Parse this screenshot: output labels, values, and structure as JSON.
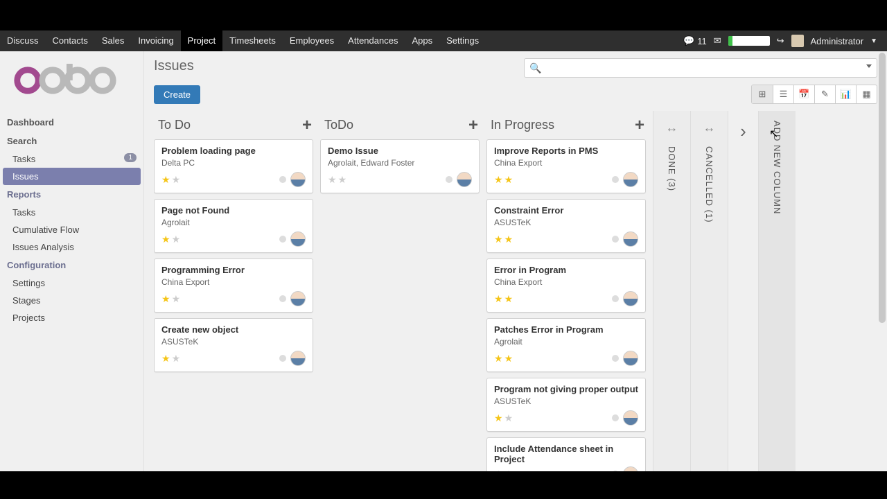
{
  "topmenu": [
    "Discuss",
    "Contacts",
    "Sales",
    "Invoicing",
    "Project",
    "Timesheets",
    "Employees",
    "Attendances",
    "Apps",
    "Settings"
  ],
  "topmenu_active": 4,
  "msg_count": "11",
  "user": "Administrator",
  "page_title": "Issues",
  "create_label": "Create",
  "sidebar": {
    "dashboard": "Dashboard",
    "search": "Search",
    "tasks": "Tasks",
    "tasks_badge": "1",
    "issues": "Issues",
    "reports": "Reports",
    "r_tasks": "Tasks",
    "r_cum": "Cumulative Flow",
    "r_iss": "Issues Analysis",
    "config": "Configuration",
    "c_settings": "Settings",
    "c_stages": "Stages",
    "c_projects": "Projects"
  },
  "columns": [
    {
      "title": "To Do",
      "cards": [
        {
          "t": "Problem loading page",
          "s": "Delta PC",
          "stars": 1
        },
        {
          "t": "Page not Found",
          "s": "Agrolait",
          "stars": 1
        },
        {
          "t": "Programming Error",
          "s": "China Export",
          "stars": 1
        },
        {
          "t": "Create new object",
          "s": "ASUSTeK",
          "stars": 1
        }
      ]
    },
    {
      "title": "ToDo",
      "cards": [
        {
          "t": "Demo Issue",
          "s": "Agrolait, Edward Foster",
          "stars": 0
        }
      ]
    },
    {
      "title": "In Progress",
      "cards": [
        {
          "t": "Improve Reports in PMS",
          "s": "China Export",
          "stars": 2
        },
        {
          "t": "Constraint Error",
          "s": "ASUSTeK",
          "stars": 2
        },
        {
          "t": "Error in Program",
          "s": "China Export",
          "stars": 2
        },
        {
          "t": "Patches Error in Program",
          "s": "Agrolait",
          "stars": 2
        },
        {
          "t": "Program not giving proper output",
          "s": "ASUSTeK",
          "stars": 1
        },
        {
          "t": "Include Attendance sheet in Project",
          "s": "",
          "stars": 0
        }
      ]
    }
  ],
  "collapsed": [
    "DONE (3)",
    "CANCELLED (1)"
  ],
  "add_col": "ADD NEW COLUMN",
  "status_url": "localhost:8080/web/?#"
}
